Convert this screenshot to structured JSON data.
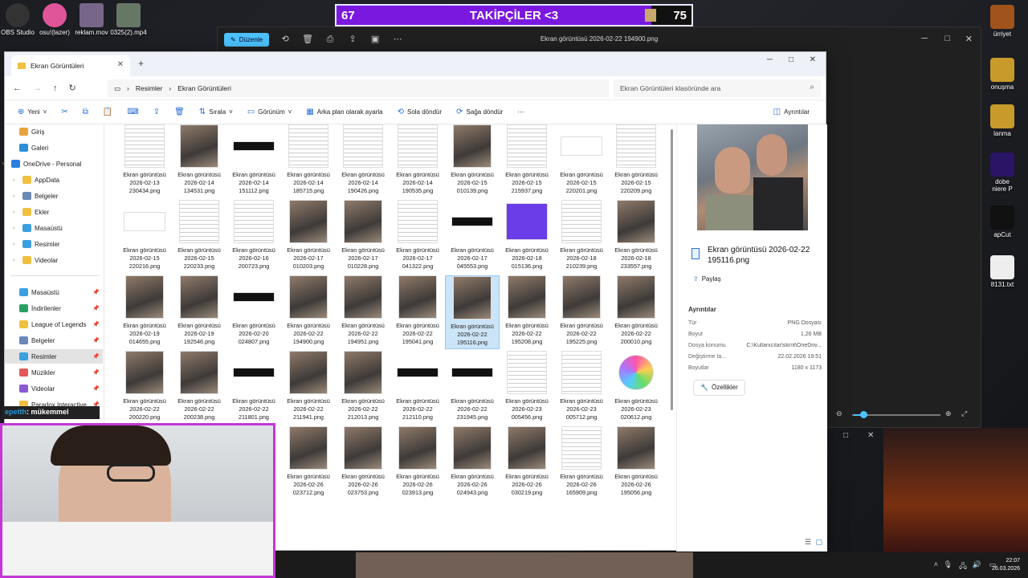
{
  "desktop": {
    "icons_left": [
      {
        "label": "OBS Studio",
        "color": "#333"
      },
      {
        "label": "osu!(lazer)",
        "color": "#e05599"
      },
      {
        "label": "reklam.mov",
        "color": "#776688"
      },
      {
        "label": "0325(2).mp4",
        "color": "#667766"
      }
    ],
    "icons_right": [
      {
        "label": "ürriyet",
        "color": "#a0531a"
      },
      {
        "label": "onuşma",
        "color": "#c79a2b"
      },
      {
        "label": "lanma",
        "color": "#c79a2b"
      },
      {
        "label": "dobe\nniere P",
        "color": "#2a1466"
      },
      {
        "label": "apCut",
        "color": "#111"
      },
      {
        "label": "8131.txt",
        "color": "#eee"
      }
    ]
  },
  "banner": {
    "left_num": "67",
    "title": "TAKİPÇİLER <3",
    "right_num": "75"
  },
  "photos_app": {
    "edit_label": "Düzenle",
    "title": "Ekran görüntüsü 2026-02-22 194900.png"
  },
  "explorer": {
    "tab_title": "Ekran Görüntüleri",
    "breadcrumb": [
      "Resimler",
      "Ekran Görüntüleri"
    ],
    "search_placeholder": "Ekran Görüntüleri klasöründe ara",
    "commands": {
      "new": "Yeni",
      "sort": "Sırala",
      "view": "Görünüm",
      "background": "Arka plan olarak ayarla",
      "rotate_left": "Sola döndür",
      "rotate_right": "Sağa döndür",
      "details": "Ayrıntılar"
    },
    "sidebar": [
      {
        "label": "Giriş",
        "color": "#e8a33d",
        "pin": false
      },
      {
        "label": "Galeri",
        "color": "#2a8fd6",
        "pin": false
      },
      {
        "label": "OneDrive - Personal",
        "color": "#2a7fe0",
        "pin": false
      },
      {
        "label": "AppData",
        "color": "#f0c040",
        "pin": false
      },
      {
        "label": "Belgeler",
        "color": "#6a88b8",
        "pin": false
      },
      {
        "label": "Ekler",
        "color": "#f0c040",
        "pin": false
      },
      {
        "label": "Masaüstü",
        "color": "#3aa0e0",
        "pin": false
      },
      {
        "label": "Resimler",
        "color": "#3aa0e0",
        "pin": false
      },
      {
        "label": "Videolar",
        "color": "#f0c040",
        "pin": false
      },
      {
        "label": "Masaüstü",
        "color": "#3aa0e0",
        "pin": true
      },
      {
        "label": "İndirilenler",
        "color": "#2aa060",
        "pin": true
      },
      {
        "label": "League of Legends",
        "color": "#f0c040",
        "pin": true
      },
      {
        "label": "Belgeler",
        "color": "#6a88b8",
        "pin": true
      },
      {
        "label": "Resimler",
        "color": "#3aa0e0",
        "pin": true
      },
      {
        "label": "Müzikler",
        "color": "#e05a5a",
        "pin": true
      },
      {
        "label": "Videolar",
        "color": "#8a5ad6",
        "pin": true
      },
      {
        "label": "Paradox Interactive",
        "color": "#f0c040",
        "pin": true
      }
    ],
    "files": [
      {
        "line1": "Ekran görüntüsü",
        "date": "2026-02-13",
        "file": "230434.png",
        "kind": "doc"
      },
      {
        "line1": "Ekran görüntüsü",
        "date": "2026-02-14",
        "file": "134531.png",
        "kind": "photo"
      },
      {
        "line1": "Ekran görüntüsü",
        "date": "2026-02-14",
        "file": "151112.png",
        "kind": "dark"
      },
      {
        "line1": "Ekran görüntüsü",
        "date": "2026-02-14",
        "file": "185715.png",
        "kind": "doc"
      },
      {
        "line1": "Ekran görüntüsü",
        "date": "2026-02-14",
        "file": "190426.png",
        "kind": "doc"
      },
      {
        "line1": "Ekran görüntüsü",
        "date": "2026-02-14",
        "file": "190535.png",
        "kind": "doc"
      },
      {
        "line1": "Ekran görüntüsü",
        "date": "2026-02-15",
        "file": "010139.png",
        "kind": "photo"
      },
      {
        "line1": "Ekran görüntüsü",
        "date": "2026-02-15",
        "file": "215937.png",
        "kind": "doc"
      },
      {
        "line1": "Ekran görüntüsü",
        "date": "2026-02-15",
        "file": "220201.png",
        "kind": "blank"
      },
      {
        "line1": "Ekran görüntüsü",
        "date": "2026-02-15",
        "file": "220209.png",
        "kind": "doc"
      },
      {
        "line1": "Ekran görüntüsü",
        "date": "2026-02-15",
        "file": "220216.png",
        "kind": "blank"
      },
      {
        "line1": "Ekran görüntüsü",
        "date": "2026-02-15",
        "file": "220233.png",
        "kind": "doc"
      },
      {
        "line1": "Ekran görüntüsü",
        "date": "2026-02-16",
        "file": "200723.png",
        "kind": "doc"
      },
      {
        "line1": "Ekran görüntüsü",
        "date": "2026-02-17",
        "file": "010203.png",
        "kind": "photo"
      },
      {
        "line1": "Ekran görüntüsü",
        "date": "2026-02-17",
        "file": "010228.png",
        "kind": "photo"
      },
      {
        "line1": "Ekran görüntüsü",
        "date": "2026-02-17",
        "file": "041322.png",
        "kind": "doc"
      },
      {
        "line1": "Ekran görüntüsü",
        "date": "2026-02-17",
        "file": "045553.png",
        "kind": "dark"
      },
      {
        "line1": "Ekran görüntüsü",
        "date": "2026-02-18",
        "file": "015136.png",
        "kind": "purple"
      },
      {
        "line1": "Ekran görüntüsü",
        "date": "2026-02-18",
        "file": "210239.png",
        "kind": "doc"
      },
      {
        "line1": "Ekran görüntüsü",
        "date": "2026-02-18",
        "file": "233557.png",
        "kind": "photo"
      },
      {
        "line1": "Ekran görüntüsü",
        "date": "2026-02-19",
        "file": "014655.png",
        "kind": "photo"
      },
      {
        "line1": "Ekran görüntüsü",
        "date": "2026-02-19",
        "file": "192546.png",
        "kind": "photo"
      },
      {
        "line1": "Ekran görüntüsü",
        "date": "2026-02-20",
        "file": "024807.png",
        "kind": "dark"
      },
      {
        "line1": "Ekran görüntüsü",
        "date": "2026-02-22",
        "file": "194900.png",
        "kind": "photo"
      },
      {
        "line1": "Ekran görüntüsü",
        "date": "2026-02-22",
        "file": "194951.png",
        "kind": "photo"
      },
      {
        "line1": "Ekran görüntüsü",
        "date": "2026-02-22",
        "file": "195041.png",
        "kind": "photo"
      },
      {
        "line1": "Ekran görüntüsü",
        "date": "2026-02-22",
        "file": "195116.png",
        "kind": "photo",
        "selected": true
      },
      {
        "line1": "Ekran görüntüsü",
        "date": "2026-02-22",
        "file": "195208.png",
        "kind": "photo"
      },
      {
        "line1": "Ekran görüntüsü",
        "date": "2026-02-22",
        "file": "195225.png",
        "kind": "photo"
      },
      {
        "line1": "Ekran görüntüsü",
        "date": "2026-02-22",
        "file": "200010.png",
        "kind": "photo"
      },
      {
        "line1": "Ekran görüntüsü",
        "date": "2026-02-22",
        "file": "200220.png",
        "kind": "photo"
      },
      {
        "line1": "Ekran görüntüsü",
        "date": "2026-02-22",
        "file": "200238.png",
        "kind": "photo"
      },
      {
        "line1": "Ekran görüntüsü",
        "date": "2026-02-22",
        "file": "211801.png",
        "kind": "dark"
      },
      {
        "line1": "Ekran görüntüsü",
        "date": "2026-02-22",
        "file": "211941.png",
        "kind": "photo"
      },
      {
        "line1": "Ekran görüntüsü",
        "date": "2026-02-22",
        "file": "212013.png",
        "kind": "photo"
      },
      {
        "line1": "Ekran görüntüsü",
        "date": "2026-02-22",
        "file": "212110.png",
        "kind": "dark"
      },
      {
        "line1": "Ekran görüntüsü",
        "date": "2026-02-22",
        "file": "231945.png",
        "kind": "dark"
      },
      {
        "line1": "Ekran görüntüsü",
        "date": "2026-02-23",
        "file": "005456.png",
        "kind": "doc"
      },
      {
        "line1": "Ekran görüntüsü",
        "date": "2026-02-23",
        "file": "005712.png",
        "kind": "doc"
      },
      {
        "line1": "Ekran görüntüsü",
        "date": "2026-02-23",
        "file": "020612.png",
        "kind": "chart"
      },
      {
        "line1": "Ekran görüntüsü",
        "date": "2026-02-26",
        "file": "023712.png",
        "kind": "photo"
      },
      {
        "line1": "Ekran görüntüsü",
        "date": "2026-02-26",
        "file": "023753.png",
        "kind": "photo"
      },
      {
        "line1": "Ekran görüntüsü",
        "date": "2026-02-26",
        "file": "023913.png",
        "kind": "photo"
      },
      {
        "line1": "Ekran görüntüsü",
        "date": "2026-02-26",
        "file": "024943.png",
        "kind": "photo"
      },
      {
        "line1": "Ekran görüntüsü",
        "date": "2026-02-26",
        "file": "030219.png",
        "kind": "photo"
      },
      {
        "line1": "Ekran görüntüsü",
        "date": "2026-02-26",
        "file": "165909.png",
        "kind": "doc"
      },
      {
        "line1": "Ekran görüntüsü",
        "date": "2026-02-26",
        "file": "195056.png",
        "kind": "photo"
      }
    ],
    "details_pane": {
      "name": "Ekran görüntüsü 2026-02-22 195116.png",
      "share": "Paylaş",
      "heading": "Ayrıntılar",
      "rows": [
        {
          "k": "Tür",
          "v": "PNG Dosyası"
        },
        {
          "k": "Boyut",
          "v": "1,26 MB"
        },
        {
          "k": "Dosya konumu",
          "v": "C:\\Kullanıcılar\\skrnt\\OneDriv..."
        },
        {
          "k": "Değiştirme ta...",
          "v": "22.02.2026 19:51"
        },
        {
          "k": "Boyutlar",
          "v": "1180 x 1173"
        }
      ],
      "properties": "Özellikler"
    }
  },
  "chat": {
    "user": "epetth",
    "message": ": mükemmel"
  },
  "clock": {
    "time": "22:07",
    "date": "26.03.2026"
  }
}
